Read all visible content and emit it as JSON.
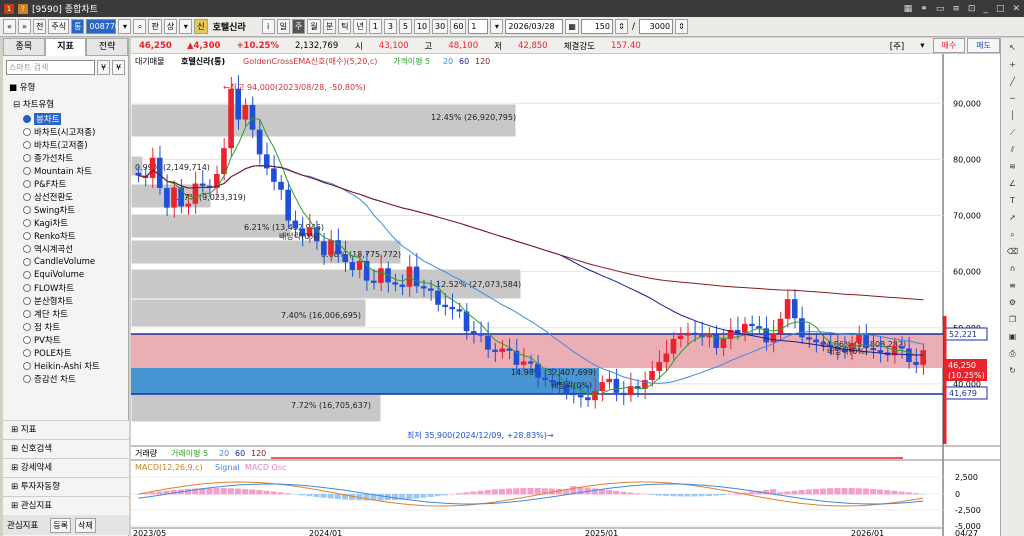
{
  "window": {
    "title": "[9590] 종합차트"
  },
  "toolbar": {
    "market_label": "주식",
    "code": "008770",
    "name": "호텔신라",
    "name_prefix": "신",
    "periods": [
      "i",
      "일",
      "주",
      "월",
      "분",
      "틱",
      "년",
      "1",
      "3",
      "5",
      "10",
      "30",
      "60"
    ],
    "date": "2026/03/28",
    "count": "150",
    "total": "3000"
  },
  "left_panel": {
    "tabs": [
      "종목",
      "지표",
      "전략"
    ],
    "search_placeholder": "스마트 검색",
    "section_type": "유형",
    "section_charttype": "차트유형",
    "chart_types": [
      "봉차트",
      "바차트(시고저종)",
      "바차트(고저종)",
      "종가선차트",
      "Mountain 차트",
      "P&F차트",
      "삼선전환도",
      "Swing차트",
      "Kagi차트",
      "Renko차트",
      "역시계곡선",
      "CandleVolume",
      "EquiVolume",
      "FLOW차트",
      "분산형차트",
      "계단 차트",
      "점 차트",
      "PV차트",
      "POLE차트",
      "Heikin-Ashi 차트",
      "증감선 차트"
    ],
    "selected_index": 0,
    "bottom_sections": [
      "지표",
      "신호검색",
      "강세약세",
      "투자자동향",
      "관심지표"
    ],
    "footer_label": "관심지표",
    "footer_buttons": [
      "등록",
      "삭제"
    ]
  },
  "quote": {
    "price": "46,250",
    "change": "▲4,300",
    "change_pct": "+10.25%",
    "volume": "2,132,769",
    "open_label": "시",
    "open": "43,100",
    "high_label": "고",
    "high": "48,100",
    "low_label": "저",
    "low": "42,850",
    "strength_label": "체결강도",
    "strength": "157.40",
    "buy_label": "매수",
    "sell_label": "매도"
  },
  "legend": {
    "main": "대기매물",
    "stock": "호텔신라(통)",
    "signal": "GoldenCrossEMA신호(매수)(5,20,c)",
    "ma_label": "가격이평 5",
    "ma_periods": [
      "20",
      "60",
      "120"
    ]
  },
  "annotations": {
    "high_note": "←최고 94,000(2023/08/28, -50.80%)",
    "low_note": "최저 35,900(2024/12/09, +28.83%)→",
    "dividend": "배당락(0%)"
  },
  "volume_profile": [
    {
      "label": "12.45% (26,920,795)"
    },
    {
      "label": "0.99% (2,149,714)"
    },
    {
      "label": "4.17% (9,023,319)"
    },
    {
      "label": "6.21% (13,432,946)"
    },
    {
      "label": "8.68% (18,775,772)"
    },
    {
      "label": "12.52% (27,073,584)"
    },
    {
      "label": "7.40% (16,006,695)"
    },
    {
      "label": "14.98% (32,407,699)"
    },
    {
      "label": "24.86% (53,808,282)"
    },
    {
      "label": "7.72% (16,705,637)"
    }
  ],
  "price_axis": [
    "90,000",
    "80,000",
    "70,000",
    "60,000",
    "50,000",
    "40,000"
  ],
  "price_tags": {
    "resistance": "52,221",
    "current": "46,250",
    "current_pct": "(10.25%)",
    "support": "41,679"
  },
  "volume_legend": {
    "title": "거래량",
    "ma": "거래이평 5",
    "periods": [
      "20",
      "60",
      "120"
    ]
  },
  "macd_legend": {
    "macd": "MACD(12,26,9,c)",
    "signal": "Signal",
    "osc": "MACD Osc"
  },
  "macd_axis": [
    "2,500",
    "0",
    "-2,500",
    "-5,000"
  ],
  "date_axis": [
    "2023/05",
    "2024/01",
    "2025/01",
    "2026/01",
    "04/27"
  ],
  "colors": {
    "up": "#e8242d",
    "down": "#1f4fd6",
    "band_red": "#e9a0a8",
    "band_blue": "#3d8fd1"
  }
}
